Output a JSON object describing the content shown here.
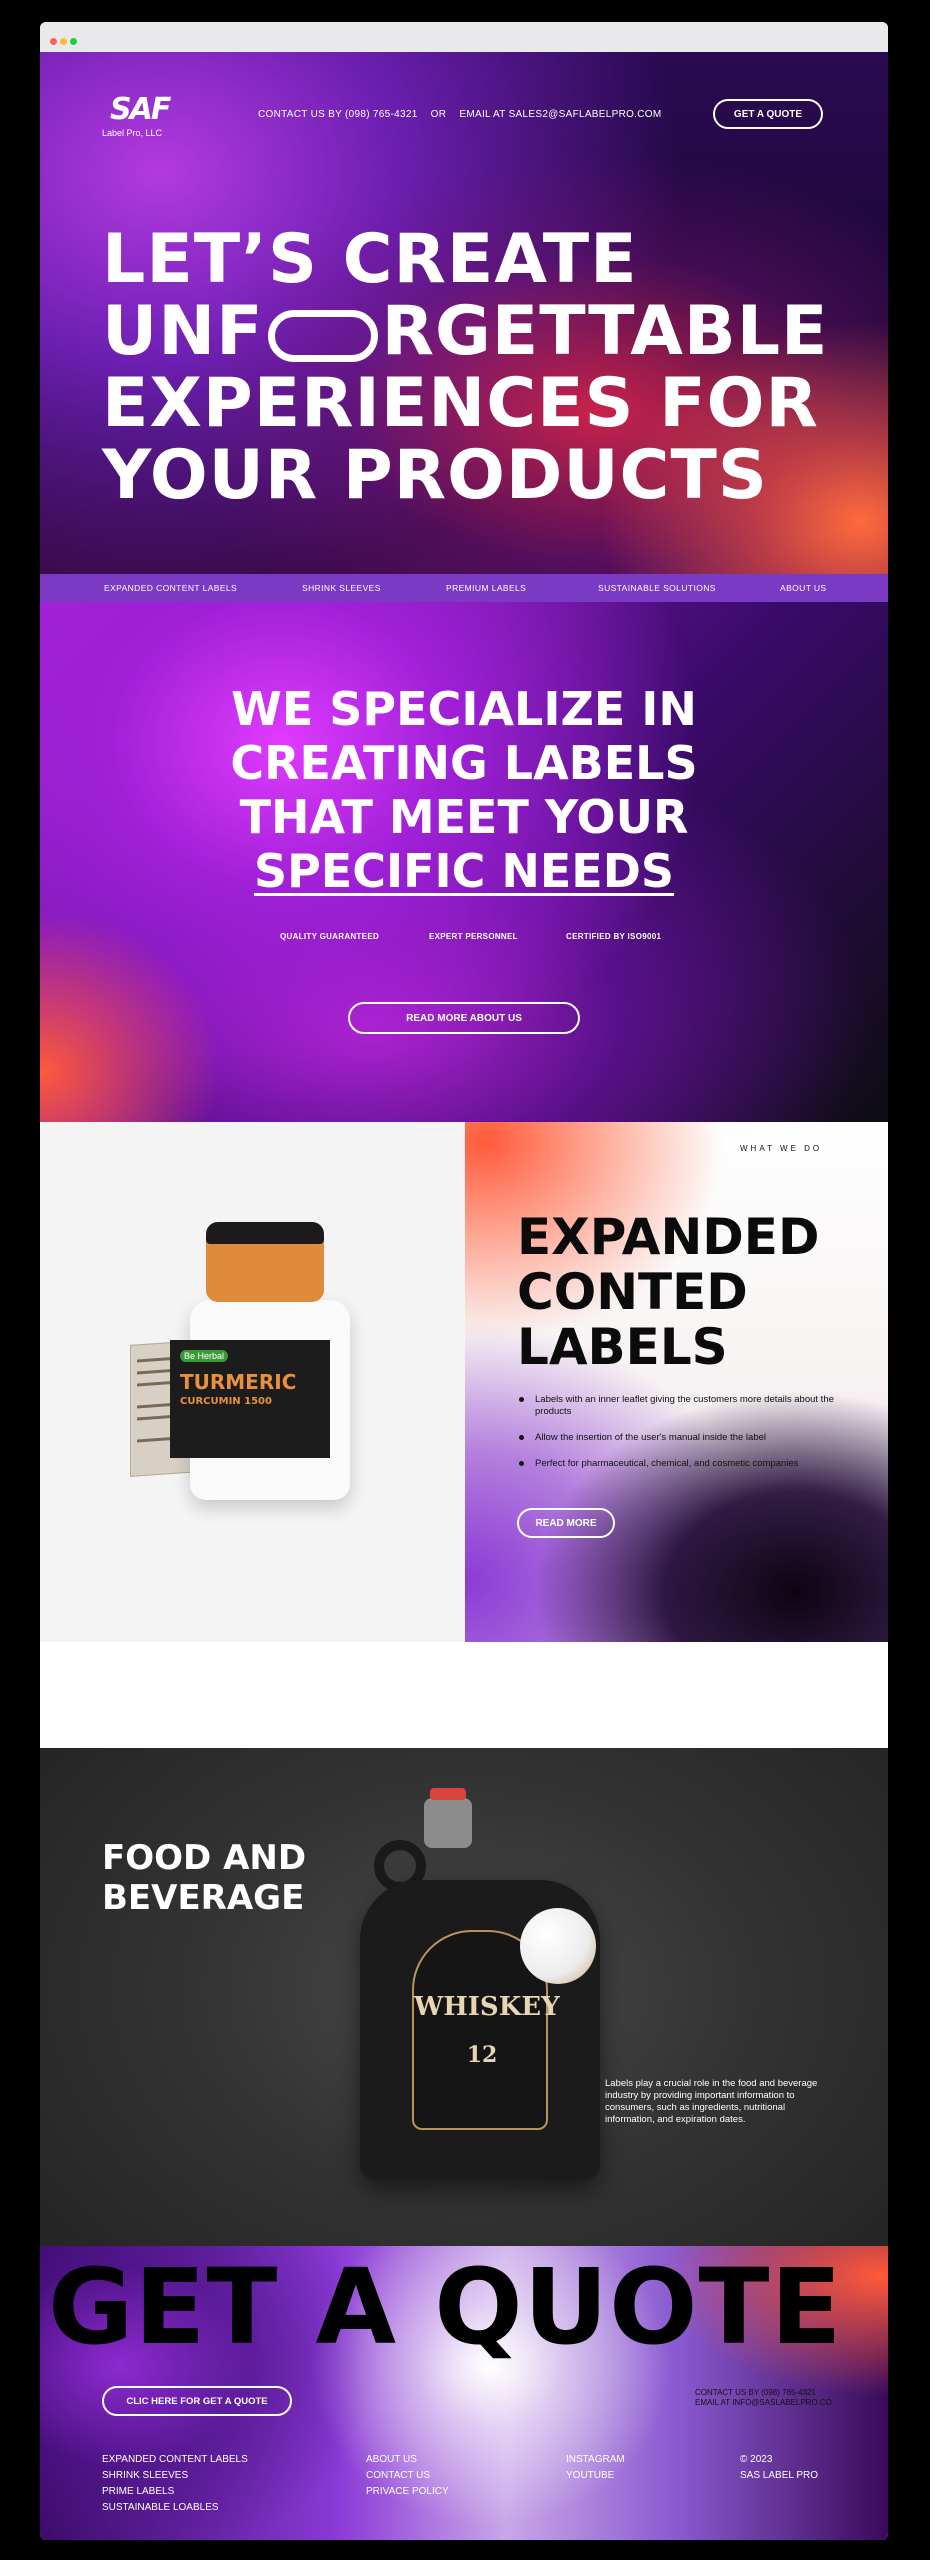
{
  "brand": {
    "logo_mark": "SAF",
    "logo_sub": "Label Pro, LLC"
  },
  "header": {
    "contact_phone": "CONTACT US BY (098) 765-4321",
    "or": "OR",
    "contact_email": "EMAIL AT SALES2@SAFLABELPRO.COM",
    "quote_button": "GET A QUOTE"
  },
  "hero": {
    "line1": "LET’S CREATE",
    "line2_a": "UNF",
    "line2_b": "RGETTABLE",
    "line3": "EXPERIENCES FOR",
    "line4": "YOUR PRODUCTS"
  },
  "nav": {
    "items": [
      "EXPANDED CONTENT LABELS",
      "SHRINK SLEEVES",
      "PREMIUM LABELS",
      "SUSTAINABLE SOLUTIONS",
      "ABOUT US"
    ]
  },
  "specialize": {
    "line1": "WE SPECIALIZE IN",
    "line2": "CREATING LABELS",
    "line3": "THAT MEET YOUR",
    "line4": "SPECIFIC NEEDS",
    "features": [
      "QUALITY GUARANTEED",
      "EXPERT PERSONNEL",
      "CERTIFIED BY ISO9001"
    ],
    "button": "READ MORE ABOUT US"
  },
  "product": {
    "kicker": "WHAT WE DO",
    "title_lines": [
      "EXPANDED",
      "CONTED",
      "LABELS"
    ],
    "bullets": [
      "Labels with an inner leaflet giving the customers more details about the products",
      "Allow the insertion of the user's manual inside the label",
      "Perfect for pharmaceutical, chemical, and cosmetic companies"
    ],
    "button": "READ MORE",
    "bottle_brand": "Be Herbal",
    "bottle_name": "TURMERIC",
    "bottle_sub": "CURCUMIN 1500"
  },
  "food": {
    "title_lines": [
      "FOOD AND",
      "BEVERAGE"
    ],
    "description": "Labels play a crucial role in the food and beverage industry by providing important information to consumers, such as ingredients, nutritional information, and expiration dates.",
    "jug_label": "WHISKEY",
    "jug_number": "12"
  },
  "footer": {
    "big_text": "GET A QUOTE NO",
    "button": "CLIC HERE FOR GET A QUOTE",
    "contact_line1": "CONTACT US BY (098) 765-4321",
    "contact_line2": "EMAIL AT INFO@SASLABELPRO.CO",
    "col1": [
      "EXPANDED CONTENT LABELS",
      "SHRINK SLEEVES",
      "PRIME LABELS",
      "SUSTAINABLE LOABLES"
    ],
    "col2": [
      "ABOUT US",
      "CONTACT US",
      "PRIVACE POLICY"
    ],
    "col3": [
      "INSTAGRAM",
      "YOUTUBE"
    ],
    "col4": [
      "© 2023",
      "SAS LABEL PRO"
    ]
  }
}
